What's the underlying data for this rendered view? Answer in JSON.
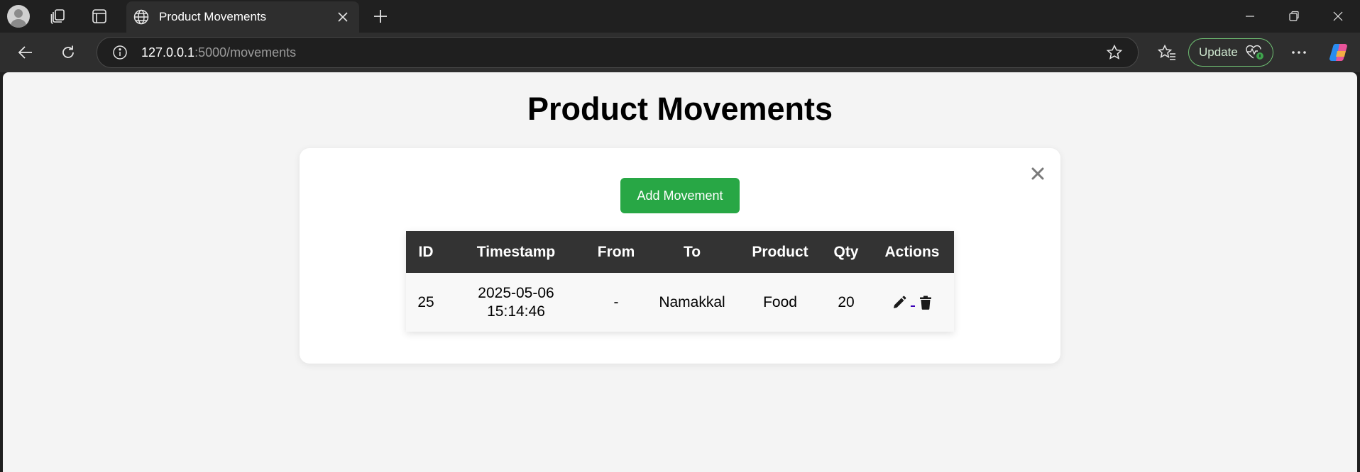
{
  "browser": {
    "tab": {
      "title": "Product Movements"
    },
    "address": {
      "host": "127.0.0.1",
      "path": ":5000/movements"
    },
    "update_label": "Update"
  },
  "page": {
    "title": "Product Movements",
    "add_button_label": "Add Movement"
  },
  "table": {
    "headers": {
      "id": "ID",
      "timestamp": "Timestamp",
      "from": "From",
      "to": "To",
      "product": "Product",
      "qty": "Qty",
      "actions": "Actions"
    },
    "rows": [
      {
        "id": "25",
        "timestamp_date": "2025-05-06",
        "timestamp_time": "15:14:46",
        "from": "-",
        "to": "Namakkal",
        "product": "Food",
        "qty": "20"
      }
    ]
  },
  "colors": {
    "accent_green": "#28a745",
    "header_dark": "#333333",
    "page_bg": "#f4f4f4"
  },
  "icons": [
    "profile-avatar-icon",
    "workspaces-icon",
    "tab-actions-icon",
    "globe-icon",
    "close-icon",
    "plus-icon",
    "minimize-icon",
    "restore-icon",
    "back-icon",
    "refresh-icon",
    "info-icon",
    "star-icon",
    "favorites-icon",
    "heart-pulse-icon",
    "more-icon",
    "copilot-icon",
    "edit-icon",
    "trash-icon"
  ]
}
